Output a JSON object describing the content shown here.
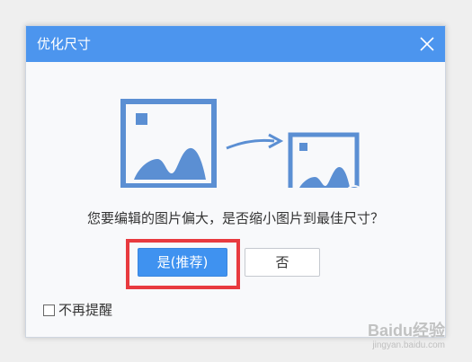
{
  "dialog": {
    "title": "优化尺寸",
    "message": "您要编辑的图片偏大，是否缩小图片到最佳尺寸？",
    "yes_button": "是(推荐)",
    "no_button": "否",
    "dont_show_again": "不再提醒",
    "dont_show_again_checked": false
  },
  "icons": {
    "close": "close-icon",
    "large_image": "image-icon",
    "arrow": "arrow-right-icon",
    "small_image": "image-icon",
    "check_badge": "check-badge-icon"
  },
  "colors": {
    "titlebar": "#4c95ee",
    "primary_button": "#3f92f0",
    "highlight_border": "#e83a3f",
    "illustration": "#5b8fd3"
  },
  "watermark": {
    "line1": "Baidu经验",
    "line2": "jingyan.baidu.com"
  }
}
